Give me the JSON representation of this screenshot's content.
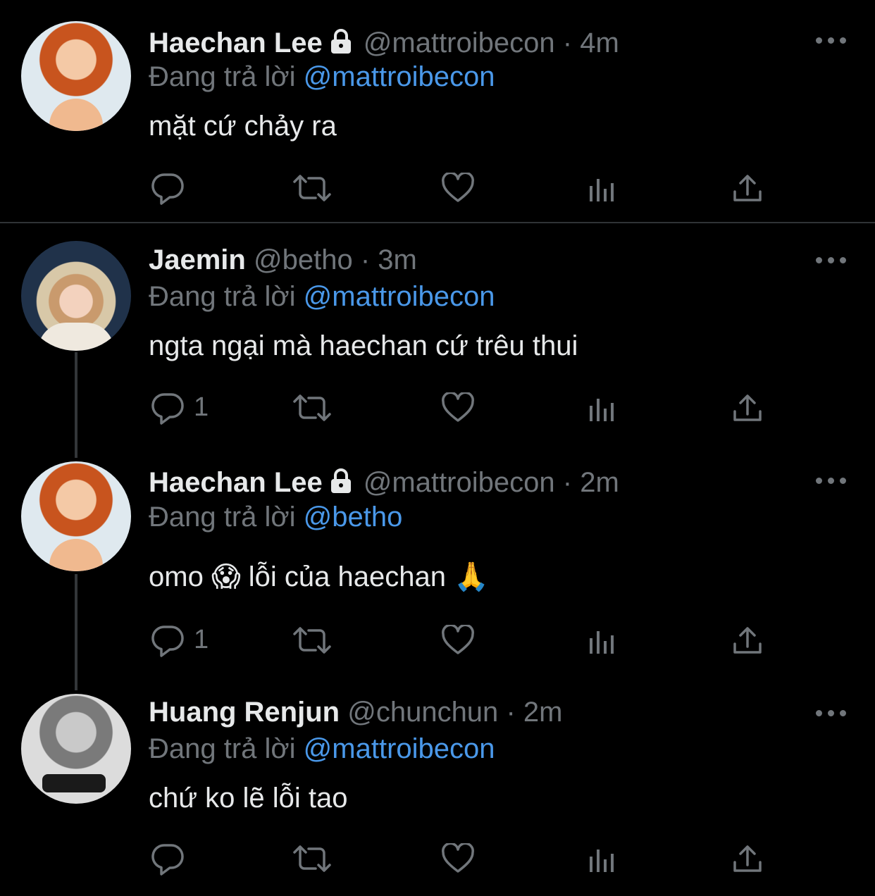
{
  "tweets": [
    {
      "name": "Haechan Lee",
      "protected": true,
      "handle": "@mattroibecon",
      "dot": "·",
      "time": "4m",
      "reply_prefix": "Đang trả lời",
      "reply_to": "@mattroibecon",
      "text": "mặt cứ chảy ra",
      "reply_count": ""
    },
    {
      "name": "Jaemin",
      "protected": false,
      "handle": "@betho",
      "dot": "·",
      "time": "3m",
      "reply_prefix": "Đang trả lời",
      "reply_to": "@mattroibecon",
      "text": "ngta ngại mà haechan cứ trêu thui",
      "reply_count": "1"
    },
    {
      "name": "Haechan Lee",
      "protected": true,
      "handle": "@mattroibecon",
      "dot": "·",
      "time": "2m",
      "reply_prefix": "Đang trả lời",
      "reply_to": "@betho",
      "text_before": "omo",
      "emoji1": "😱",
      "text_middle": "lỗi của haechan",
      "emoji2": "🙏",
      "reply_count": "1"
    },
    {
      "name": "Huang Renjun",
      "protected": false,
      "handle": "@chunchun",
      "dot": "·",
      "time": "2m",
      "reply_prefix": "Đang trả lời",
      "reply_to": "@mattroibecon",
      "text": "chứ ko lẽ lỗi tao",
      "reply_count": ""
    }
  ],
  "icons": {
    "reply": "reply-icon",
    "retweet": "retweet-icon",
    "like": "like-icon",
    "analytics": "analytics-icon",
    "share": "share-icon",
    "more": "more-icon",
    "lock": "lock-icon"
  },
  "colors": {
    "background": "#000000",
    "text": "#e7e9ea",
    "secondary": "#71767b",
    "link": "#4a98e9"
  }
}
